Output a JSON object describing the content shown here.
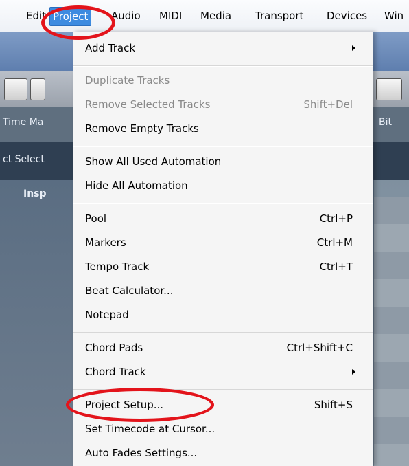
{
  "menubar": {
    "items": [
      "Edit",
      "Project",
      "Audio",
      "MIDI",
      "Media",
      "Transport",
      "Devices",
      "Win"
    ]
  },
  "background": {
    "ruler_label": "Time Ma",
    "ruler_right_label": "Bit",
    "select_label": "ct Select",
    "inspector_label": "Insp"
  },
  "menu": {
    "items": [
      {
        "label": "Add Track",
        "submenu": true
      },
      {
        "label": "Duplicate Tracks",
        "disabled": true
      },
      {
        "label": "Remove Selected Tracks",
        "shortcut": "Shift+Del",
        "disabled": true
      },
      {
        "label": "Remove Empty Tracks"
      },
      {
        "label": "Show All Used Automation"
      },
      {
        "label": "Hide All Automation"
      },
      {
        "label": "Pool",
        "shortcut": "Ctrl+P"
      },
      {
        "label": "Markers",
        "shortcut": "Ctrl+M"
      },
      {
        "label": "Tempo Track",
        "shortcut": "Ctrl+T"
      },
      {
        "label": "Beat Calculator..."
      },
      {
        "label": "Notepad"
      },
      {
        "label": "Chord Pads",
        "shortcut": "Ctrl+Shift+C"
      },
      {
        "label": "Chord Track",
        "submenu": true
      },
      {
        "label": "Project Setup...",
        "shortcut": "Shift+S"
      },
      {
        "label": "Set Timecode at Cursor..."
      },
      {
        "label": "Auto Fades Settings..."
      }
    ]
  },
  "colors": {
    "active_menu": "#3d8be0",
    "annotation": "#e3141b"
  }
}
